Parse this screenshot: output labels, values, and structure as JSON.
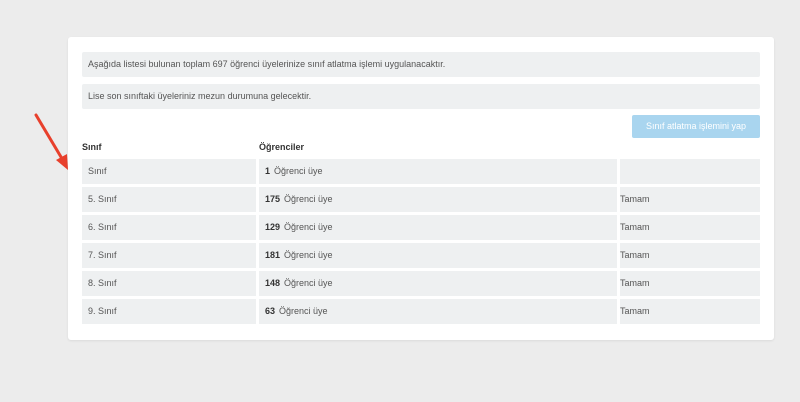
{
  "notices": {
    "total": "Aşağıda listesi bulunan toplam 697 öğrenci üyelerinize sınıf atlatma işlemi uygulanacaktır.",
    "graduation": "Lise son sınıftaki üyeleriniz mezun durumuna gelecektir."
  },
  "action_button": "Sınıf atlatma işlemini yap",
  "table": {
    "headers": [
      "Sınıf",
      "Öğrenciler"
    ],
    "unit_label": "Öğrenci üye",
    "rows": [
      {
        "grade": "Sınıf",
        "count": "1",
        "status": ""
      },
      {
        "grade": "5. Sınıf",
        "count": "175",
        "status": "Tamam"
      },
      {
        "grade": "6. Sınıf",
        "count": "129",
        "status": "Tamam"
      },
      {
        "grade": "7. Sınıf",
        "count": "181",
        "status": "Tamam"
      },
      {
        "grade": "8. Sınıf",
        "count": "148",
        "status": "Tamam"
      },
      {
        "grade": "9. Sınıf",
        "count": "63",
        "status": "Tamam"
      }
    ]
  },
  "colors": {
    "arrow": "#e8402c",
    "button": "#a9d5ef",
    "row_bg": "#eef0f1"
  },
  "icons": {
    "annotation": "red-arrow-icon"
  }
}
